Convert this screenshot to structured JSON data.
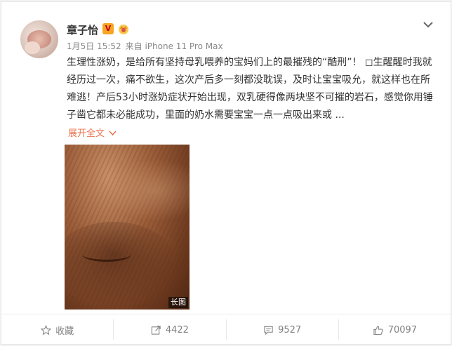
{
  "post": {
    "username": "章子怡",
    "vip_badge": "V",
    "time": "1月5日 15:52",
    "source": "来自 iPhone 11 Pro Max",
    "content": "生理性涨奶，是给所有坚持母乳喂养的宝妈们上的最摧残的“酷刑”！ ◻生醒醒时我就经历过一次，痛不欲生，这次产后多一刻都没耽误，及时让宝宝吸允，就这样也在所难逃！产后53小时涨奶症状开始出现，双乳硬得像两块坚不可摧的岩石，感觉你用锤子凿它都未必能成功，里面的奶水需要宝宝一点一点吸出来或 ...",
    "expand_label": "展开全文",
    "image_badge": "长图"
  },
  "toolbar": {
    "favorite_label": "收藏",
    "repost_count": "4422",
    "comment_count": "9527",
    "like_count": "70097"
  },
  "colors": {
    "accent": "#eb7350",
    "text": "#333333",
    "muted": "#888888",
    "vip": "#f6a623"
  }
}
